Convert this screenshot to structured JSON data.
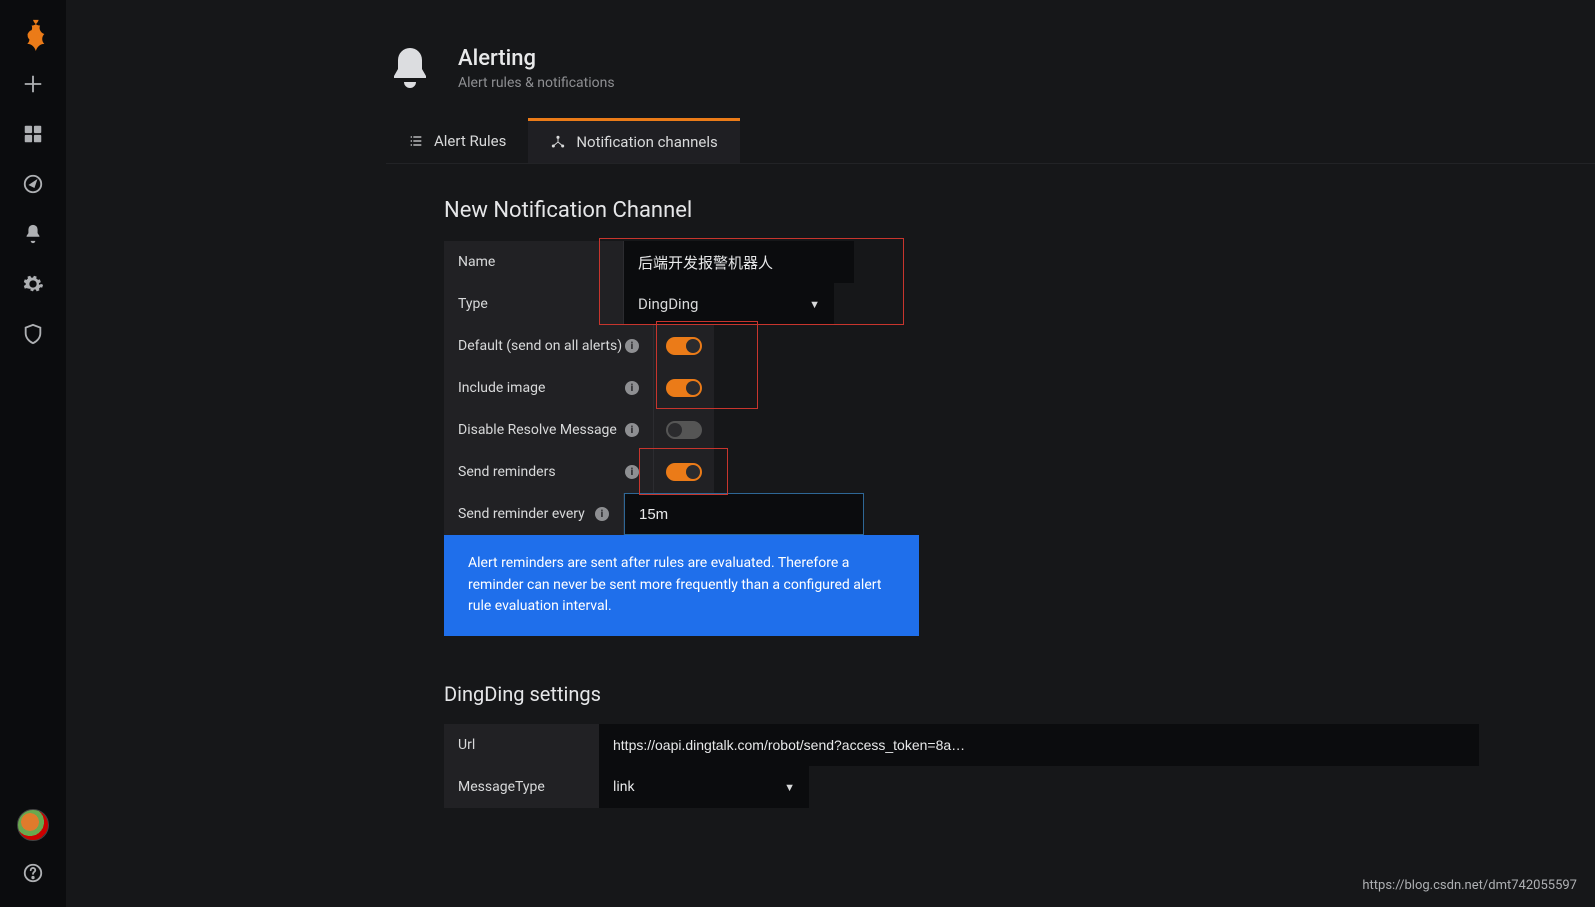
{
  "header": {
    "title": "Alerting",
    "subtitle": "Alert rules & notifications"
  },
  "tabs": {
    "alertRules": "Alert Rules",
    "notificationChannels": "Notification channels"
  },
  "section": {
    "title": "New Notification Channel"
  },
  "form": {
    "name": {
      "label": "Name",
      "value": "后端开发报警机器人"
    },
    "type": {
      "label": "Type",
      "value": "DingDing"
    },
    "defaultAll": {
      "label": "Default (send on all alerts)",
      "on": true
    },
    "includeImage": {
      "label": "Include image",
      "on": true
    },
    "disableResolve": {
      "label": "Disable Resolve Message",
      "on": false
    },
    "sendReminders": {
      "label": "Send reminders",
      "on": true
    },
    "reminderEvery": {
      "label": "Send reminder every",
      "value": "15m"
    },
    "infoText": "Alert reminders are sent after rules are evaluated. Therefore a reminder can never be sent more frequently than a configured alert rule evaluation interval."
  },
  "dingding": {
    "title": "DingDing settings",
    "url": {
      "label": "Url",
      "value": "https://oapi.dingtalk.com/robot/send?access_token=8a…"
    },
    "messageType": {
      "label": "MessageType",
      "value": "link"
    }
  },
  "watermark": "https://blog.csdn.net/dmt742055597"
}
